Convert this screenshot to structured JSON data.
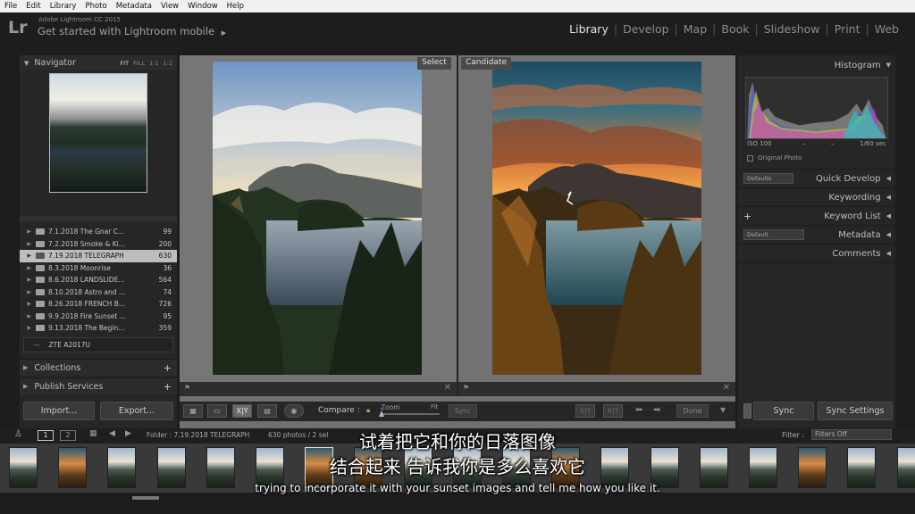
{
  "menu": [
    "File",
    "Edit",
    "Library",
    "Photo",
    "Metadata",
    "View",
    "Window",
    "Help"
  ],
  "app": {
    "logo": "Lr",
    "version": "Adobe Lightroom CC 2015",
    "mobile_prompt": "Get started with Lightroom mobile",
    "mobile_arrow": "▶",
    "modules": [
      "Library",
      "Develop",
      "Map",
      "Book",
      "Slideshow",
      "Print",
      "Web"
    ],
    "module_sep": "|"
  },
  "navigator": {
    "title": "Navigator",
    "zoom_options": [
      "FIT",
      "FILL",
      "1:1",
      "1:2"
    ],
    "chevron": "▼"
  },
  "folders": [
    {
      "name": "7.1.2018 The Gnar C...",
      "count": "99",
      "selected": false
    },
    {
      "name": "7.2.2018 Smoke & Ki...",
      "count": "200",
      "selected": false
    },
    {
      "name": "7.19.2018 TELEGRAPH",
      "count": "630",
      "selected": true
    },
    {
      "name": "8.3.2018 Moonrise",
      "count": "36",
      "selected": false
    },
    {
      "name": "8.6.2018 LANDSLIDE...",
      "count": "564",
      "selected": false
    },
    {
      "name": "8.10.2018 Astro and ...",
      "count": "74",
      "selected": false
    },
    {
      "name": "8.26.2018 FRENCH B...",
      "count": "726",
      "selected": false
    },
    {
      "name": "9.9.2018 Fire Sunset ...",
      "count": "95",
      "selected": false
    },
    {
      "name": "9.13.2018 The Begin...",
      "count": "359",
      "selected": false
    }
  ],
  "volume": {
    "name": "ZTE A2017U",
    "icon": "—"
  },
  "left_sections": [
    {
      "label": "Collections",
      "plus": "+"
    },
    {
      "label": "Publish Services",
      "plus": "+"
    }
  ],
  "left_buttons": {
    "import": "Import...",
    "export": "Export..."
  },
  "compare": {
    "select_tag": "Select",
    "candidate_tag": "Candidate",
    "label": "Compare :",
    "zoom": "Zoom",
    "fit": "Fit",
    "sync": "Sync",
    "done": "Done",
    "xy": "X|Y"
  },
  "histogram": {
    "title": "Histogram",
    "iso": "ISO 100",
    "dash1": "–",
    "dash2": "–",
    "shutter": "1/60 sec",
    "original_photo": "Original Photo"
  },
  "right_panels": [
    {
      "label": "Quick Develop",
      "select": "Defaults"
    },
    {
      "label": "Keywording",
      "select": ""
    },
    {
      "label": "Keyword List",
      "select": "",
      "plus": "+"
    },
    {
      "label": "Metadata",
      "select": "Default"
    },
    {
      "label": "Comments",
      "select": ""
    }
  ],
  "right_buttons": {
    "sync": "Sync",
    "sync_settings": "Sync Settings"
  },
  "filmstrip": {
    "page1": "1",
    "page2": "2",
    "folder": "Folder : 7.19.2018 TELEGRAPH",
    "count": "630 photos / 2 sel",
    "filter_label": "Filter :",
    "filter_value": "Filters Off"
  },
  "subtitles": {
    "line1": "试着把它和你的日落图像",
    "line2": "结合起来 告诉我你是多么喜欢它",
    "line3": "trying to incorporate it with your sunset images and tell me how you like it."
  }
}
